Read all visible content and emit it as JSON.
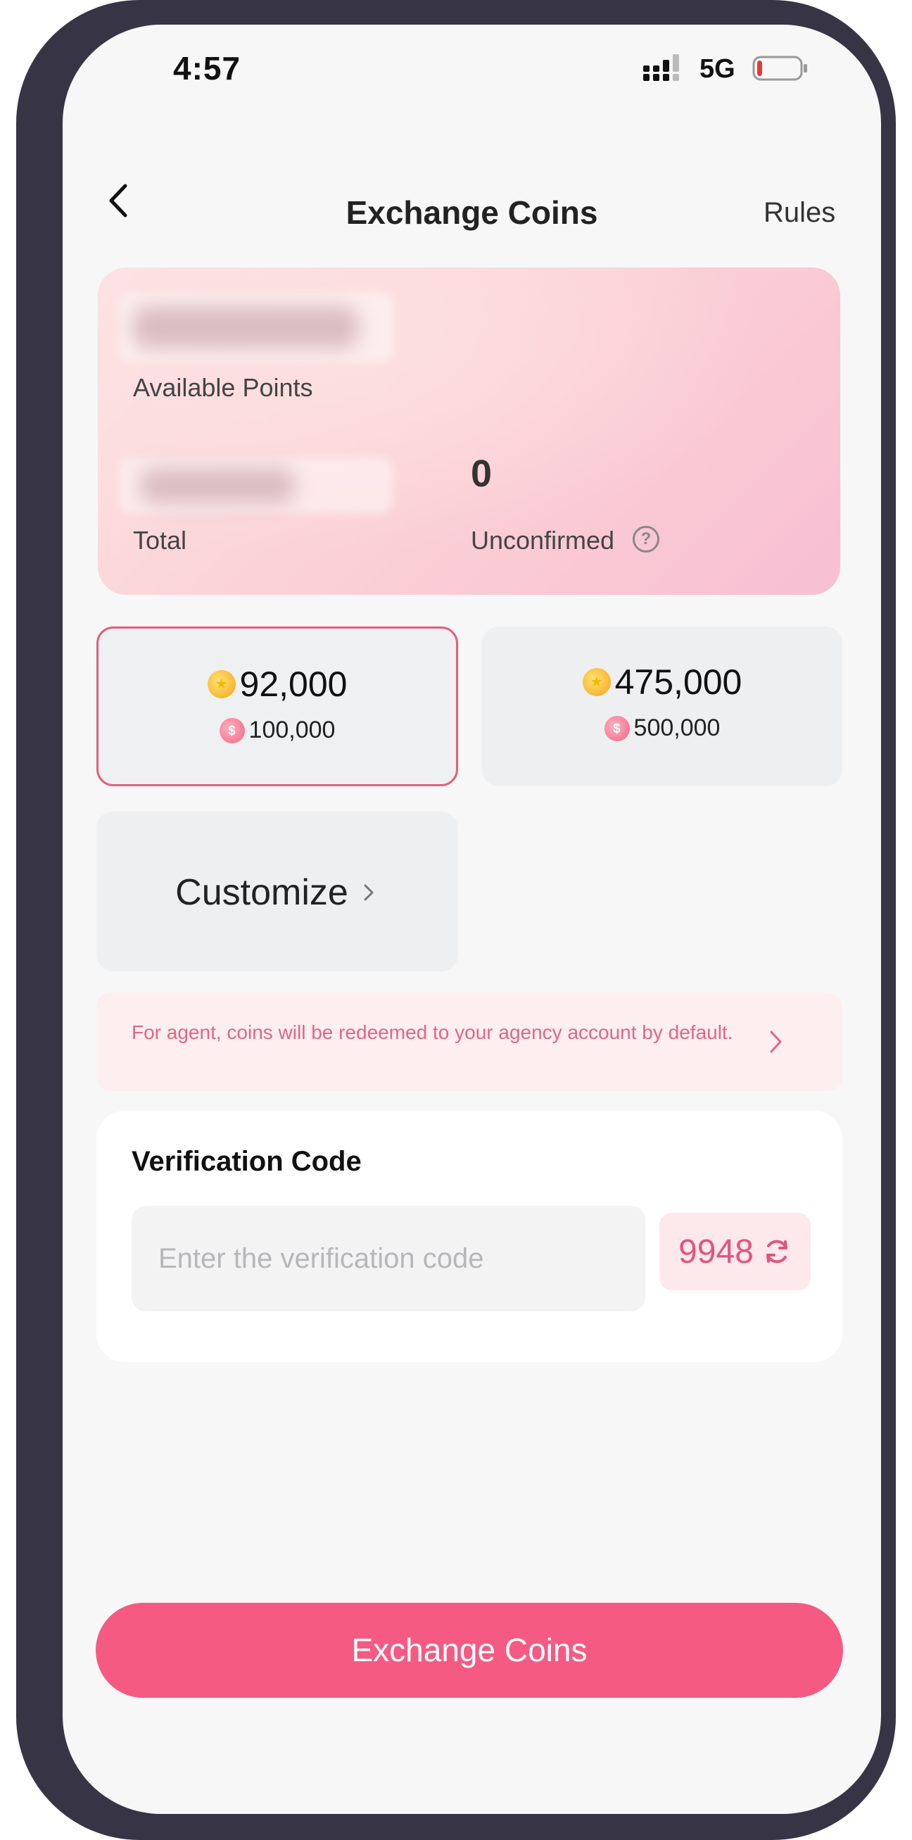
{
  "status_bar": {
    "time": "4:57",
    "network": "5G",
    "battery_level": 0.12,
    "battery_color": "#e53935"
  },
  "header": {
    "title": "Exchange Coins",
    "rules_label": "Rules"
  },
  "points_card": {
    "available_label": "Available Points",
    "total_label": "Total",
    "unconfirmed_value": "0",
    "unconfirmed_label": "Unconfirmed",
    "help_icon": "?"
  },
  "options": [
    {
      "coins": "92,000",
      "points": "100,000",
      "selected": true
    },
    {
      "coins": "475,000",
      "points": "500,000",
      "selected": false
    }
  ],
  "customize": {
    "label": "Customize"
  },
  "notice": {
    "text": "For agent, coins will be redeemed to your agency account by default."
  },
  "verification": {
    "title": "Verification Code",
    "placeholder": "Enter the verification code",
    "code": "9948"
  },
  "cta": {
    "label": "Exchange Coins"
  },
  "colors": {
    "accent": "#f55a83",
    "accent_text": "#e0567a",
    "selected_border": "#e0607c",
    "device_frame": "#363445"
  }
}
